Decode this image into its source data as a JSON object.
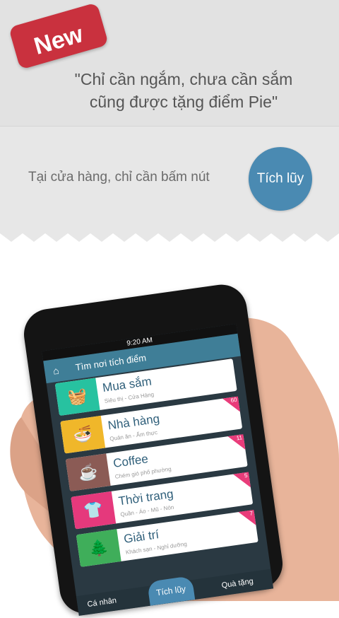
{
  "banner": {
    "badge": "New",
    "quote": "\"Chỉ cần ngắm, chưa cần sắm cũng được tặng điểm Pie\"",
    "subtitle": "Tại cửa hàng, chỉ cần bấm nút",
    "cta_label": "Tích lũy",
    "colors": {
      "badge": "#c9313e",
      "cta": "#4a8ab2",
      "background": "#e7e7e7"
    }
  },
  "phone": {
    "status_time": "9:20 AM",
    "app_title": "Tìm nơi tích điểm",
    "categories": [
      {
        "name": "Mua sắm",
        "desc": "Siêu thị - Cửa Hàng",
        "color": "#27c2a0",
        "icon": "basket-icon",
        "glyph": "🧺",
        "count": ""
      },
      {
        "name": "Nhà hàng",
        "desc": "Quán ăn - Ẩm thực",
        "color": "#f0b72a",
        "icon": "bowl-icon",
        "glyph": "🍜",
        "count": "60"
      },
      {
        "name": "Coffee",
        "desc": "Chém gió phố phường",
        "color": "#8b5b55",
        "icon": "cup-icon",
        "glyph": "☕",
        "count": "11"
      },
      {
        "name": "Thời trang",
        "desc": "Quần - Áo - Mũ - Nón",
        "color": "#e5397c",
        "icon": "shirt-icon",
        "glyph": "👕",
        "count": "5"
      },
      {
        "name": "Giải trí",
        "desc": "Khách sạn - Nghỉ dưỡng",
        "color": "#3fae5a",
        "icon": "tree-icon",
        "glyph": "🌲",
        "count": "7"
      }
    ],
    "tabs": {
      "left": "Cá nhân",
      "center": "Tích lũy",
      "right": "Quà tặng"
    }
  }
}
